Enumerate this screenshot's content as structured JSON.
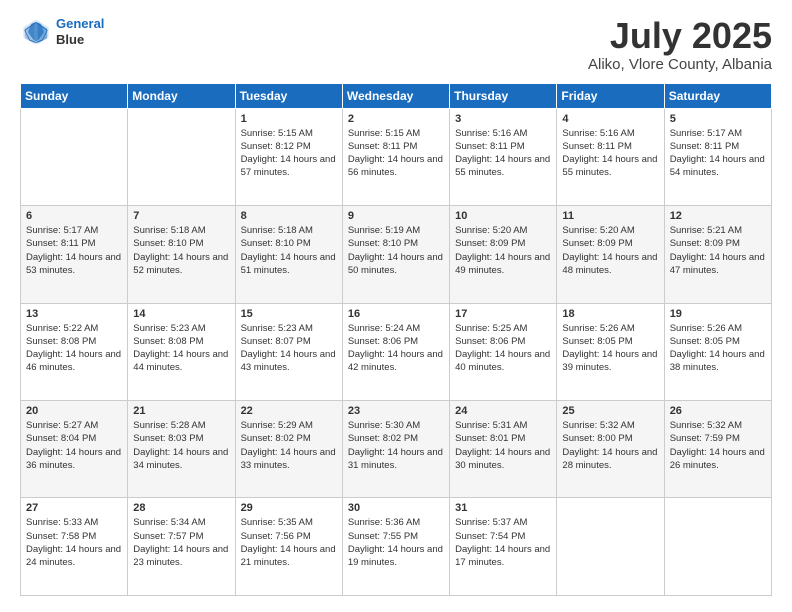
{
  "logo": {
    "line1": "General",
    "line2": "Blue"
  },
  "title": "July 2025",
  "subtitle": "Aliko, Vlore County, Albania",
  "weekdays": [
    "Sunday",
    "Monday",
    "Tuesday",
    "Wednesday",
    "Thursday",
    "Friday",
    "Saturday"
  ],
  "weeks": [
    [
      {
        "day": "",
        "sunrise": "",
        "sunset": "",
        "daylight": ""
      },
      {
        "day": "",
        "sunrise": "",
        "sunset": "",
        "daylight": ""
      },
      {
        "day": "1",
        "sunrise": "Sunrise: 5:15 AM",
        "sunset": "Sunset: 8:12 PM",
        "daylight": "Daylight: 14 hours and 57 minutes."
      },
      {
        "day": "2",
        "sunrise": "Sunrise: 5:15 AM",
        "sunset": "Sunset: 8:11 PM",
        "daylight": "Daylight: 14 hours and 56 minutes."
      },
      {
        "day": "3",
        "sunrise": "Sunrise: 5:16 AM",
        "sunset": "Sunset: 8:11 PM",
        "daylight": "Daylight: 14 hours and 55 minutes."
      },
      {
        "day": "4",
        "sunrise": "Sunrise: 5:16 AM",
        "sunset": "Sunset: 8:11 PM",
        "daylight": "Daylight: 14 hours and 55 minutes."
      },
      {
        "day": "5",
        "sunrise": "Sunrise: 5:17 AM",
        "sunset": "Sunset: 8:11 PM",
        "daylight": "Daylight: 14 hours and 54 minutes."
      }
    ],
    [
      {
        "day": "6",
        "sunrise": "Sunrise: 5:17 AM",
        "sunset": "Sunset: 8:11 PM",
        "daylight": "Daylight: 14 hours and 53 minutes."
      },
      {
        "day": "7",
        "sunrise": "Sunrise: 5:18 AM",
        "sunset": "Sunset: 8:10 PM",
        "daylight": "Daylight: 14 hours and 52 minutes."
      },
      {
        "day": "8",
        "sunrise": "Sunrise: 5:18 AM",
        "sunset": "Sunset: 8:10 PM",
        "daylight": "Daylight: 14 hours and 51 minutes."
      },
      {
        "day": "9",
        "sunrise": "Sunrise: 5:19 AM",
        "sunset": "Sunset: 8:10 PM",
        "daylight": "Daylight: 14 hours and 50 minutes."
      },
      {
        "day": "10",
        "sunrise": "Sunrise: 5:20 AM",
        "sunset": "Sunset: 8:09 PM",
        "daylight": "Daylight: 14 hours and 49 minutes."
      },
      {
        "day": "11",
        "sunrise": "Sunrise: 5:20 AM",
        "sunset": "Sunset: 8:09 PM",
        "daylight": "Daylight: 14 hours and 48 minutes."
      },
      {
        "day": "12",
        "sunrise": "Sunrise: 5:21 AM",
        "sunset": "Sunset: 8:09 PM",
        "daylight": "Daylight: 14 hours and 47 minutes."
      }
    ],
    [
      {
        "day": "13",
        "sunrise": "Sunrise: 5:22 AM",
        "sunset": "Sunset: 8:08 PM",
        "daylight": "Daylight: 14 hours and 46 minutes."
      },
      {
        "day": "14",
        "sunrise": "Sunrise: 5:23 AM",
        "sunset": "Sunset: 8:08 PM",
        "daylight": "Daylight: 14 hours and 44 minutes."
      },
      {
        "day": "15",
        "sunrise": "Sunrise: 5:23 AM",
        "sunset": "Sunset: 8:07 PM",
        "daylight": "Daylight: 14 hours and 43 minutes."
      },
      {
        "day": "16",
        "sunrise": "Sunrise: 5:24 AM",
        "sunset": "Sunset: 8:06 PM",
        "daylight": "Daylight: 14 hours and 42 minutes."
      },
      {
        "day": "17",
        "sunrise": "Sunrise: 5:25 AM",
        "sunset": "Sunset: 8:06 PM",
        "daylight": "Daylight: 14 hours and 40 minutes."
      },
      {
        "day": "18",
        "sunrise": "Sunrise: 5:26 AM",
        "sunset": "Sunset: 8:05 PM",
        "daylight": "Daylight: 14 hours and 39 minutes."
      },
      {
        "day": "19",
        "sunrise": "Sunrise: 5:26 AM",
        "sunset": "Sunset: 8:05 PM",
        "daylight": "Daylight: 14 hours and 38 minutes."
      }
    ],
    [
      {
        "day": "20",
        "sunrise": "Sunrise: 5:27 AM",
        "sunset": "Sunset: 8:04 PM",
        "daylight": "Daylight: 14 hours and 36 minutes."
      },
      {
        "day": "21",
        "sunrise": "Sunrise: 5:28 AM",
        "sunset": "Sunset: 8:03 PM",
        "daylight": "Daylight: 14 hours and 34 minutes."
      },
      {
        "day": "22",
        "sunrise": "Sunrise: 5:29 AM",
        "sunset": "Sunset: 8:02 PM",
        "daylight": "Daylight: 14 hours and 33 minutes."
      },
      {
        "day": "23",
        "sunrise": "Sunrise: 5:30 AM",
        "sunset": "Sunset: 8:02 PM",
        "daylight": "Daylight: 14 hours and 31 minutes."
      },
      {
        "day": "24",
        "sunrise": "Sunrise: 5:31 AM",
        "sunset": "Sunset: 8:01 PM",
        "daylight": "Daylight: 14 hours and 30 minutes."
      },
      {
        "day": "25",
        "sunrise": "Sunrise: 5:32 AM",
        "sunset": "Sunset: 8:00 PM",
        "daylight": "Daylight: 14 hours and 28 minutes."
      },
      {
        "day": "26",
        "sunrise": "Sunrise: 5:32 AM",
        "sunset": "Sunset: 7:59 PM",
        "daylight": "Daylight: 14 hours and 26 minutes."
      }
    ],
    [
      {
        "day": "27",
        "sunrise": "Sunrise: 5:33 AM",
        "sunset": "Sunset: 7:58 PM",
        "daylight": "Daylight: 14 hours and 24 minutes."
      },
      {
        "day": "28",
        "sunrise": "Sunrise: 5:34 AM",
        "sunset": "Sunset: 7:57 PM",
        "daylight": "Daylight: 14 hours and 23 minutes."
      },
      {
        "day": "29",
        "sunrise": "Sunrise: 5:35 AM",
        "sunset": "Sunset: 7:56 PM",
        "daylight": "Daylight: 14 hours and 21 minutes."
      },
      {
        "day": "30",
        "sunrise": "Sunrise: 5:36 AM",
        "sunset": "Sunset: 7:55 PM",
        "daylight": "Daylight: 14 hours and 19 minutes."
      },
      {
        "day": "31",
        "sunrise": "Sunrise: 5:37 AM",
        "sunset": "Sunset: 7:54 PM",
        "daylight": "Daylight: 14 hours and 17 minutes."
      },
      {
        "day": "",
        "sunrise": "",
        "sunset": "",
        "daylight": ""
      },
      {
        "day": "",
        "sunrise": "",
        "sunset": "",
        "daylight": ""
      }
    ]
  ]
}
